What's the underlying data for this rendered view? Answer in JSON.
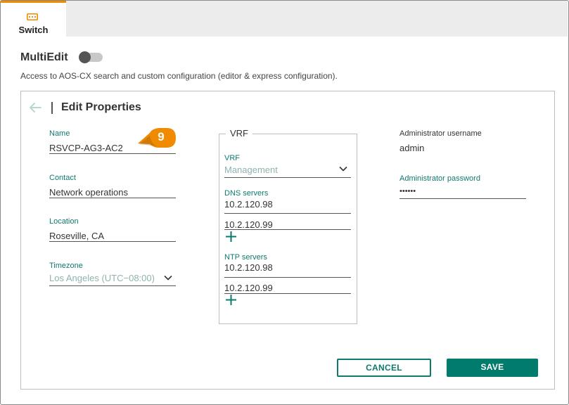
{
  "tab": {
    "label": "Switch",
    "icon": "switch-icon",
    "accent": "#f08a00"
  },
  "multiedit": {
    "label": "MultiEdit",
    "enabled": false,
    "description": "Access to AOS-CX search and custom configuration (editor & express configuration)."
  },
  "panel": {
    "title": "Edit Properties",
    "back_icon": "arrow-left-icon"
  },
  "callout": {
    "number": "9",
    "color": "#f08a00"
  },
  "left_fields": {
    "name": {
      "label": "Name",
      "value": "RSVCP-AG3-AC2"
    },
    "contact": {
      "label": "Contact",
      "value": "Network operations"
    },
    "location": {
      "label": "Location",
      "value": "Roseville, CA"
    },
    "timezone": {
      "label": "Timezone",
      "value": "Los Angeles (UTC−08:00)"
    }
  },
  "vrf": {
    "legend": "VRF",
    "select_label": "VRF",
    "select_value": "Management",
    "dns_label": "DNS servers",
    "dns_servers": [
      "10.2.120.98",
      "10.2.120.99"
    ],
    "ntp_label": "NTP servers",
    "ntp_servers": [
      "10.2.120.98",
      "10.2.120.99"
    ]
  },
  "admin": {
    "username_label": "Administrator username",
    "username": "admin",
    "password_label": "Administrator password",
    "password": "••••••"
  },
  "buttons": {
    "cancel": "CANCEL",
    "save": "SAVE"
  },
  "colors": {
    "teal": "#0e7a6e",
    "save_bg": "#017c6c"
  }
}
